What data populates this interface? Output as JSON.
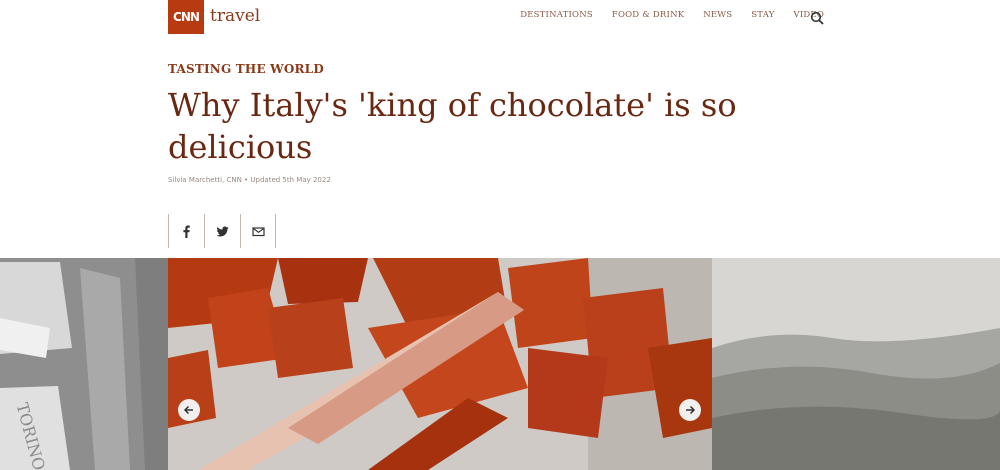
{
  "header": {
    "logo_text": "CNN",
    "section_word": "travel",
    "nav": [
      "DESTINATIONS",
      "FOOD & DRINK",
      "NEWS",
      "STAY",
      "VIDEO"
    ],
    "search_icon": "search-icon",
    "brand_color": "#b83a10"
  },
  "article": {
    "kicker": "TASTING THE WORLD",
    "headline": "Why Italy's 'king of chocolate' is so delicious",
    "byline": "Silvia Marchetti, CNN • Updated 5th May 2022",
    "share": [
      "facebook-icon",
      "twitter-icon",
      "email-icon"
    ],
    "text_color": "#6a2812"
  },
  "gallery": {
    "prev_icon": "arrow-left-icon",
    "next_icon": "arrow-right-icon",
    "left_image_text": "TORINO",
    "chocolate_color": "#b83a10"
  }
}
